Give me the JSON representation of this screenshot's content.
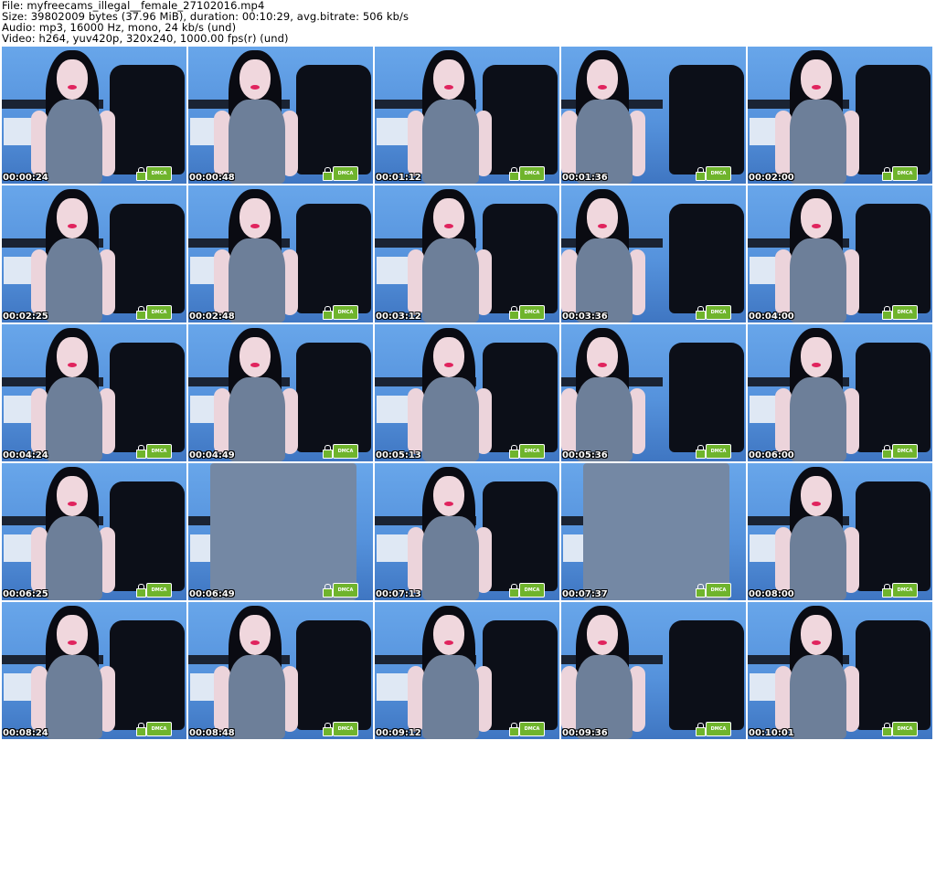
{
  "header": {
    "file_line": "File: myfreecams_illegal__female_27102016.mp4",
    "size_line": "Size: 39802009 bytes (37.96 MiB), duration: 00:10:29, avg.bitrate: 506 kb/s",
    "audio_line": "Audio: mp3, 16000 Hz, mono, 24 kb/s (und)",
    "video_line": "Video: h264, yuv420p, 320x240, 1000.00 fps(r) (und)"
  },
  "watermark_label": "DMCA",
  "colors": {
    "wall": "#5a97e0",
    "dress": "#6d7f99",
    "chair": "#0c0f18",
    "badge": "#6fb42c"
  },
  "thumbnails": [
    {
      "time": "00:00:24"
    },
    {
      "time": "00:00:48"
    },
    {
      "time": "00:01:12"
    },
    {
      "time": "00:01:36"
    },
    {
      "time": "00:02:00"
    },
    {
      "time": "00:02:25"
    },
    {
      "time": "00:02:48"
    },
    {
      "time": "00:03:12"
    },
    {
      "time": "00:03:36"
    },
    {
      "time": "00:04:00"
    },
    {
      "time": "00:04:24"
    },
    {
      "time": "00:04:49"
    },
    {
      "time": "00:05:13"
    },
    {
      "time": "00:05:36"
    },
    {
      "time": "00:06:00"
    },
    {
      "time": "00:06:25"
    },
    {
      "time": "00:06:49"
    },
    {
      "time": "00:07:13"
    },
    {
      "time": "00:07:37"
    },
    {
      "time": "00:08:00"
    },
    {
      "time": "00:08:24"
    },
    {
      "time": "00:08:48"
    },
    {
      "time": "00:09:12"
    },
    {
      "time": "00:09:36"
    },
    {
      "time": "00:10:01"
    }
  ]
}
